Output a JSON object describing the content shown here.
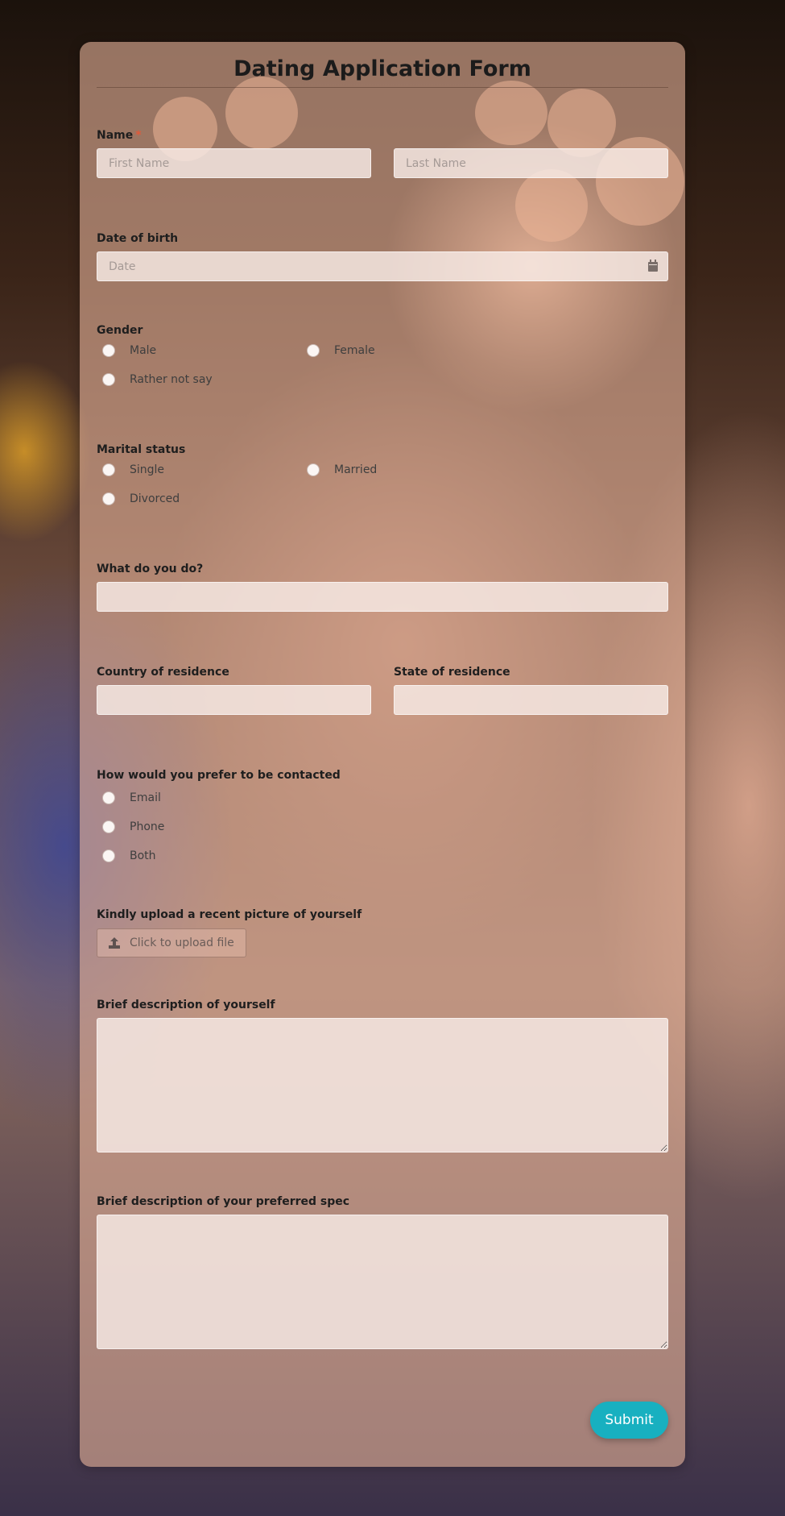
{
  "form": {
    "title": "Dating Application Form",
    "name": {
      "label": "Name",
      "required_mark": "*",
      "first_placeholder": "First Name",
      "last_placeholder": "Last Name"
    },
    "dob": {
      "label": "Date of birth",
      "placeholder": "Date",
      "icon": "calendar-icon"
    },
    "gender": {
      "label": "Gender",
      "options": [
        "Male",
        "Female",
        "Rather not say"
      ]
    },
    "marital": {
      "label": "Marital status",
      "options": [
        "Single",
        "Married",
        "Divorced"
      ]
    },
    "occupation": {
      "label": "What do you do?"
    },
    "country": {
      "label": "Country of residence"
    },
    "state": {
      "label": "State of residence"
    },
    "contact": {
      "label": "How would you prefer to be contacted",
      "options": [
        "Email",
        "Phone",
        "Both"
      ]
    },
    "picture": {
      "label": "Kindly upload a recent picture of yourself",
      "button_label": "Click to upload file",
      "icon": "upload-icon"
    },
    "self_description": {
      "label": "Brief description of yourself"
    },
    "preferred_description": {
      "label": "Brief description of your preferred spec"
    },
    "submit_label": "Submit"
  },
  "colors": {
    "submit_button": "#18b0c0",
    "required_mark": "#e05a3a",
    "card_background": "#e1af96"
  }
}
